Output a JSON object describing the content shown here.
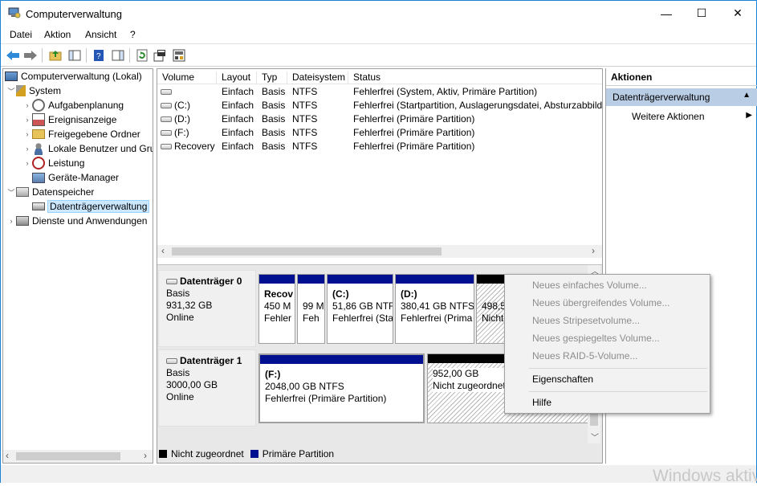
{
  "window": {
    "title": "Computerverwaltung",
    "minimize": "—",
    "maximize": "☐",
    "close": "✕"
  },
  "menu": [
    "Datei",
    "Aktion",
    "Ansicht",
    "?"
  ],
  "tree": {
    "root": "Computerverwaltung (Lokal)",
    "system": "System",
    "items": [
      "Aufgabenplanung",
      "Ereignisanzeige",
      "Freigegebene Ordner",
      "Lokale Benutzer und Gruppen",
      "Leistung",
      "Geräte-Manager"
    ],
    "storage": "Datenspeicher",
    "disk_mgmt": "Datenträgerverwaltung",
    "services": "Dienste und Anwendungen"
  },
  "volumes": {
    "columns": [
      "Volume",
      "Layout",
      "Typ",
      "Dateisystem",
      "Status"
    ],
    "rows": [
      {
        "volume": "",
        "layout": "Einfach",
        "type": "Basis",
        "fs": "NTFS",
        "status": "Fehlerfrei (System, Aktiv, Primäre Partition)"
      },
      {
        "volume": "(C:)",
        "layout": "Einfach",
        "type": "Basis",
        "fs": "NTFS",
        "status": "Fehlerfrei (Startpartition, Auslagerungsdatei, Absturzabbild"
      },
      {
        "volume": "(D:)",
        "layout": "Einfach",
        "type": "Basis",
        "fs": "NTFS",
        "status": "Fehlerfrei (Primäre Partition)"
      },
      {
        "volume": "(F:)",
        "layout": "Einfach",
        "type": "Basis",
        "fs": "NTFS",
        "status": "Fehlerfrei (Primäre Partition)"
      },
      {
        "volume": "Recovery",
        "layout": "Einfach",
        "type": "Basis",
        "fs": "NTFS",
        "status": "Fehlerfrei (Primäre Partition)"
      }
    ]
  },
  "disks": [
    {
      "name": "Datenträger 0",
      "type": "Basis",
      "size": "931,32 GB",
      "state": "Online",
      "partitions": [
        {
          "line1": "Recov",
          "line2": "450 M",
          "line3": "Fehler"
        },
        {
          "line1": "",
          "line2": "99 M",
          "line3": "Feh"
        },
        {
          "line1": "(C:)",
          "line2": "51,86 GB NTF",
          "line3": "Fehlerfrei (Sta"
        },
        {
          "line1": "(D:)",
          "line2": "380,41 GB NTFS",
          "line3": "Fehlerfrei (Prima"
        },
        {
          "line1": "",
          "line2": "498,5",
          "line3": "Nicht"
        }
      ]
    },
    {
      "name": "Datenträger 1",
      "type": "Basis",
      "size": "3000,00 GB",
      "state": "Online",
      "partitions": [
        {
          "line1": "(F:)",
          "line2": "2048,00 GB NTFS",
          "line3": "Fehlerfrei (Primäre Partition)"
        },
        {
          "line1": "",
          "line2": "952,00 GB",
          "line3": "Nicht zugeordnet"
        }
      ]
    }
  ],
  "legend": {
    "unallocated": "Nicht zugeordnet",
    "primary": "Primäre Partition"
  },
  "actions": {
    "header": "Aktionen",
    "section": "Datenträgerverwaltung",
    "more": "Weitere Aktionen"
  },
  "context_menu": {
    "disabled": [
      "Neues einfaches Volume...",
      "Neues übergreifendes Volume...",
      "Neues Stripesetvolume...",
      "Neues gespiegeltes Volume...",
      "Neues RAID-5-Volume..."
    ],
    "properties": "Eigenschaften",
    "help": "Hilfe"
  },
  "watermark": "Windows aktiv",
  "colors": {
    "primary_partition": "#000f8f",
    "unallocated": "#000000",
    "selection": "#cce8ff",
    "action_section": "#b9cde5"
  }
}
